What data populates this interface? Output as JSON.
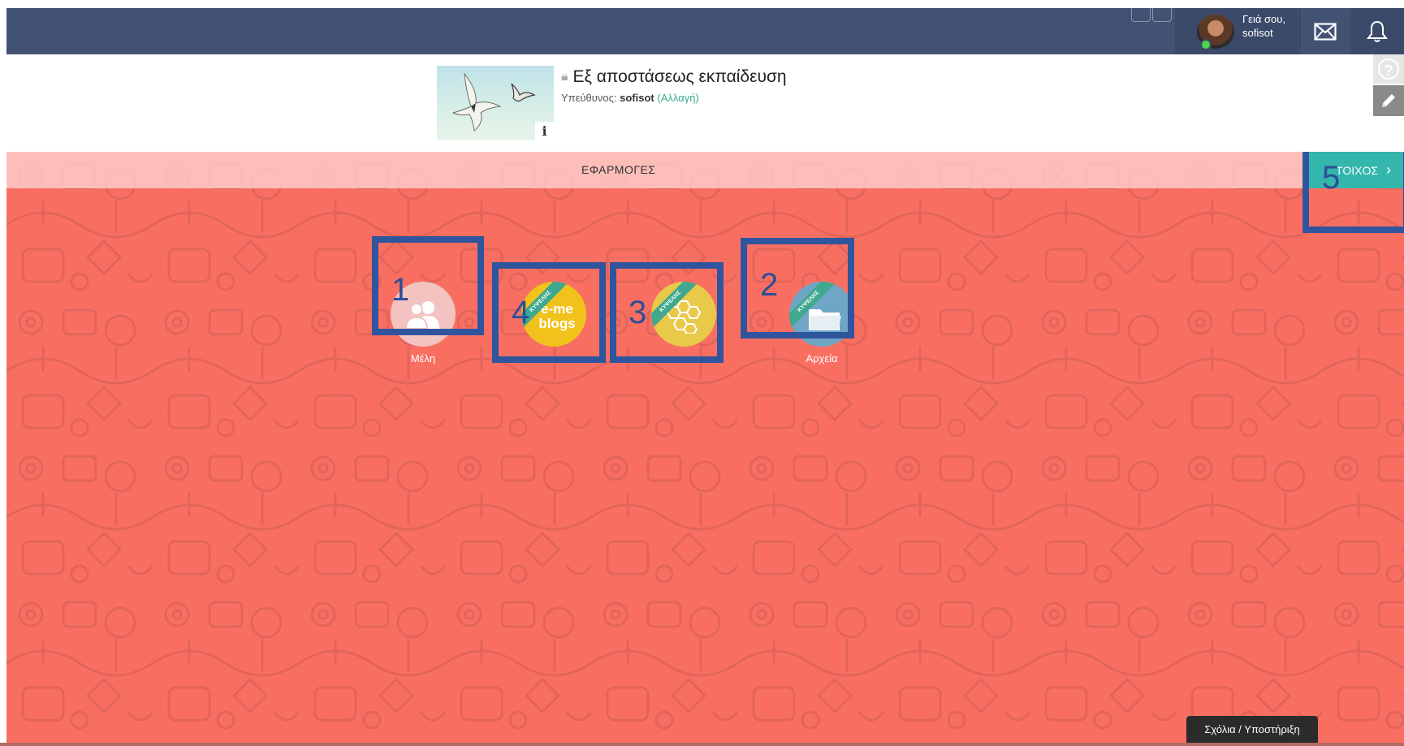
{
  "topbar": {
    "greeting_line1": "Γειά σου,",
    "username": "sofisot",
    "mail_icon": "envelope-icon",
    "bell_icon": "bell-icon"
  },
  "course": {
    "title": "Εξ αποστάσεως εκπαίδευση",
    "manager_prefix": "Υπεύθυνος:",
    "manager_name": "sofisot",
    "change_link": "(Αλλαγή)",
    "info_glyph": "i"
  },
  "side_tools": {
    "help_glyph": "?"
  },
  "tabs": {
    "apps_label": "ΕΦΑΡΜΟΓΕΣ",
    "wall_label": "ΤΟΙΧΟΣ"
  },
  "apps": [
    {
      "label": "Μέλη",
      "icon": "members-icon",
      "color": "#f2c3c0"
    },
    {
      "label": "",
      "icon": "e-me-blogs-icon",
      "color": "#f1c21b",
      "icon_text": "e-me\nblogs",
      "ribbon": "ΚΥΨΕΛΗΣ"
    },
    {
      "label": "",
      "icon": "hive-icon",
      "color": "#e9c94a",
      "ribbon": "ΚΥΨΕΛΗΣ"
    },
    {
      "label": "Αρχεία",
      "icon": "folder-icon",
      "color": "#6fa6c6",
      "ribbon": "ΚΥΨΕΛΗΣ"
    }
  ],
  "annotations": [
    "1",
    "2",
    "3",
    "4",
    "5"
  ],
  "feedback_button": "Σχόλια / Υποστήριξη",
  "colors": {
    "topbar": "#425273",
    "background": "#f86f62",
    "accent_teal": "#34b6ad",
    "annotation_blue": "#30559f"
  }
}
